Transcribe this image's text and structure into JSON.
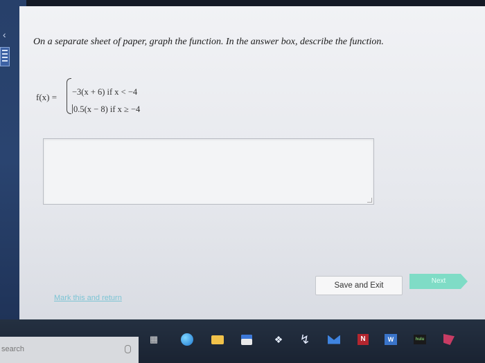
{
  "question": {
    "text": "On a separate sheet of paper, graph the function. In the answer box, describe the function."
  },
  "function": {
    "name": "f(x) =",
    "piece1": "−3(x + 6) if x < −4",
    "piece2": "0.5(x − 8) if x ≥ −4"
  },
  "answer_box": {
    "value": ""
  },
  "actions": {
    "mark_link": "Mark this and return",
    "save_label": "Save and Exit",
    "next_label": "Next"
  },
  "taskbar": {
    "search_placeholder": "search",
    "icons": [
      "microphone-icon",
      "task-view-icon",
      "edge-icon",
      "file-explorer-icon",
      "store-icon",
      "dropbox-icon",
      "bolt-icon",
      "mail-icon",
      "onenote-icon",
      "word-icon",
      "hulu-icon",
      "pinned-app-icon"
    ],
    "onenote_letter": "N",
    "word_letter": "W",
    "hulu_text": "hulu"
  },
  "colors": {
    "next_button": "#7fdcc6",
    "link": "#7cc4d4",
    "page_bg": "#eceef2"
  }
}
